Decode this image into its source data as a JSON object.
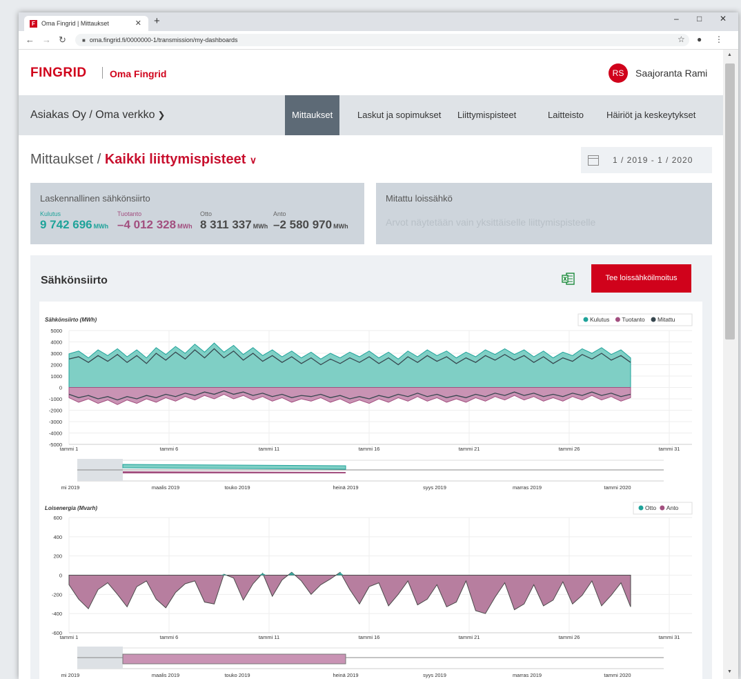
{
  "browser": {
    "tab_title": "Oma Fingrid | Mittaukset",
    "tab_favicon": "F",
    "new_tab": "+",
    "url": "oma.fingrid.fi/0000000-1/transmission/my-dashboards",
    "controls": {
      "minimize": "–",
      "maximize": "□",
      "close": "✕"
    }
  },
  "header": {
    "logo": "FINGRID",
    "portal_name": "Oma Fingrid",
    "user_initials": "RS",
    "user_name": "Saajoranta Rami",
    "brand_color": "#d0021b"
  },
  "nav": {
    "organization": "Asiakas Oy / Oma verkko",
    "items": [
      {
        "label": "Mittaukset",
        "active": true
      },
      {
        "label": "Laskut ja sopimukset",
        "active": false
      },
      {
        "label": "Liittymispisteet",
        "active": false
      },
      {
        "label": "Laitteisto",
        "active": false
      },
      {
        "label": "Häiriöt ja keskeytykset",
        "active": false
      }
    ]
  },
  "breadcrumb": {
    "root": "Mittaukset /",
    "selected": "Kaikki liittymispisteet"
  },
  "date_range": {
    "text": "1 / 2019  -  1 / 2020"
  },
  "summary": {
    "title": "Laskennallinen sähkönsiirto",
    "metrics": [
      {
        "label": "Kulutus",
        "value": "9 742 696",
        "unit": "MWh",
        "color": "#1fa39a"
      },
      {
        "label": "Tuotanto",
        "value": "–4 012 328",
        "unit": "MWh",
        "color": "#a24f7f"
      },
      {
        "label": "Otto",
        "value": "8 311 337",
        "unit": "MWh",
        "color": "#4a4a4a"
      },
      {
        "label": "Anto",
        "value": "–2 580 970",
        "unit": "MWh",
        "color": "#4a4a4a"
      }
    ]
  },
  "reactive": {
    "title": "Mitattu loissähkö",
    "note": "Arvot näytetään vain yksittäiselle liittymispisteelle"
  },
  "panel": {
    "title": "Sähkönsiirto",
    "export_icon": "excel-icon",
    "report_button": "Tee loissähköilmoitus"
  },
  "chart_data": [
    {
      "type": "area",
      "title": "Sähkönsiirto (MWh)",
      "ylim": [
        -5000,
        5000
      ],
      "y_ticks": [
        "5000",
        "4000",
        "3000",
        "2000",
        "1000",
        "0",
        "-1000",
        "-2000",
        "-3000",
        "-4000",
        "-5000"
      ],
      "x_ticks": [
        "tammi 1",
        "tammi 6",
        "tammi 11",
        "tammi 16",
        "tammi 21",
        "tammi 26",
        "tammi 31"
      ],
      "navigator_ticks": [
        "mi 2019",
        "maalis 2019",
        "touko 2019",
        "heinä 2019",
        "syys 2019",
        "marras 2019",
        "tammi 2020"
      ],
      "legend": [
        {
          "name": "Kulutus",
          "color": "#1fa39a"
        },
        {
          "name": "Tuotanto",
          "color": "#a24f7f"
        },
        {
          "name": "Mitattu",
          "color": "#37474f"
        }
      ],
      "series": [
        {
          "name": "Kulutus",
          "values": [
            2950,
            3200,
            2600,
            3300,
            2800,
            3400,
            2700,
            3300,
            2600,
            3500,
            2900,
            3600,
            3000,
            3800,
            3100,
            3900,
            3100,
            3700,
            2900,
            3500,
            2800,
            3300,
            2700,
            3200,
            2600,
            3100,
            2500,
            3000,
            2600,
            3100,
            2700,
            3200,
            2600,
            3100,
            2500,
            3200,
            2700,
            3300,
            2800,
            3200,
            2600,
            3100,
            2700,
            3300,
            2900,
            3400,
            2900,
            3300,
            2700,
            3200,
            2600,
            3100,
            2800,
            3400,
            3000,
            3500,
            2900,
            3300,
            2600
          ]
        },
        {
          "name": "Tuotanto",
          "values": [
            -900,
            -1300,
            -1000,
            -1400,
            -1100,
            -1500,
            -1100,
            -1400,
            -1000,
            -1300,
            -900,
            -1200,
            -800,
            -1100,
            -700,
            -1000,
            -600,
            -1000,
            -700,
            -1100,
            -800,
            -1200,
            -900,
            -1300,
            -1000,
            -1200,
            -900,
            -1300,
            -1000,
            -1400,
            -1100,
            -1400,
            -1000,
            -1300,
            -900,
            -1200,
            -800,
            -1200,
            -900,
            -1300,
            -1000,
            -1300,
            -900,
            -1200,
            -800,
            -1100,
            -700,
            -1100,
            -800,
            -1200,
            -900,
            -1200,
            -800,
            -1100,
            -700,
            -1100,
            -800,
            -1200,
            -900
          ]
        },
        {
          "name": "Mitattu",
          "values": [
            2500,
            2700,
            2200,
            2800,
            2300,
            2900,
            2200,
            2800,
            2100,
            3000,
            2400,
            3100,
            2500,
            3300,
            2600,
            3400,
            2600,
            3200,
            2400,
            3000,
            2300,
            2800,
            2200,
            2700,
            2100,
            2600,
            2000,
            2500,
            2100,
            2600,
            2200,
            2700,
            2100,
            2600,
            2000,
            2700,
            2200,
            2800,
            2300,
            2700,
            2100,
            2600,
            2200,
            2800,
            2400,
            2900,
            2400,
            2800,
            2200,
            2700,
            2100,
            2600,
            2300,
            2900,
            2500,
            3000,
            2400,
            2800,
            2200
          ]
        },
        {
          "name": "Mitattu (anto)",
          "values": [
            -600,
            -900,
            -700,
            -1000,
            -800,
            -1100,
            -800,
            -1000,
            -700,
            -900,
            -600,
            -800,
            -500,
            -700,
            -400,
            -600,
            -300,
            -600,
            -400,
            -700,
            -500,
            -800,
            -600,
            -900,
            -700,
            -800,
            -600,
            -900,
            -700,
            -1000,
            -800,
            -1000,
            -700,
            -900,
            -600,
            -800,
            -500,
            -800,
            -600,
            -900,
            -700,
            -900,
            -600,
            -800,
            -500,
            -700,
            -400,
            -700,
            -500,
            -800,
            -600,
            -800,
            -500,
            -700,
            -400,
            -700,
            -500,
            -800,
            -600
          ]
        }
      ]
    },
    {
      "type": "area",
      "title": "Loisenergia (Mvarh)",
      "ylim": [
        -600,
        600
      ],
      "y_ticks": [
        "600",
        "400",
        "200",
        "0",
        "-200",
        "-400",
        "-600"
      ],
      "x_ticks": [
        "tammi 1",
        "tammi 6",
        "tammi 11",
        "tammi 16",
        "tammi 21",
        "tammi 26",
        "tammi 31"
      ],
      "navigator_ticks": [
        "mi 2019",
        "maalis 2019",
        "touko 2019",
        "heinä 2019",
        "syys 2019",
        "marras 2019",
        "tammi 2020"
      ],
      "legend": [
        {
          "name": "Otto",
          "color": "#1fa39a"
        },
        {
          "name": "Anto",
          "color": "#a24f7f"
        }
      ],
      "series": [
        {
          "name": "Loisenergia",
          "values": [
            -100,
            -250,
            -350,
            -150,
            -80,
            -200,
            -330,
            -120,
            -60,
            -250,
            -340,
            -180,
            -90,
            -60,
            -280,
            -300,
            10,
            -30,
            -260,
            -90,
            20,
            -220,
            -50,
            30,
            -60,
            -200,
            -100,
            -40,
            30,
            -150,
            -300,
            -120,
            -80,
            -320,
            -200,
            -60,
            -310,
            -250,
            -100,
            -330,
            -280,
            -60,
            -370,
            -400,
            -230,
            -80,
            -360,
            -300,
            -100,
            -320,
            -260,
            -70,
            -300,
            -210,
            -60,
            -320,
            -210,
            -80,
            -330
          ]
        }
      ]
    }
  ]
}
